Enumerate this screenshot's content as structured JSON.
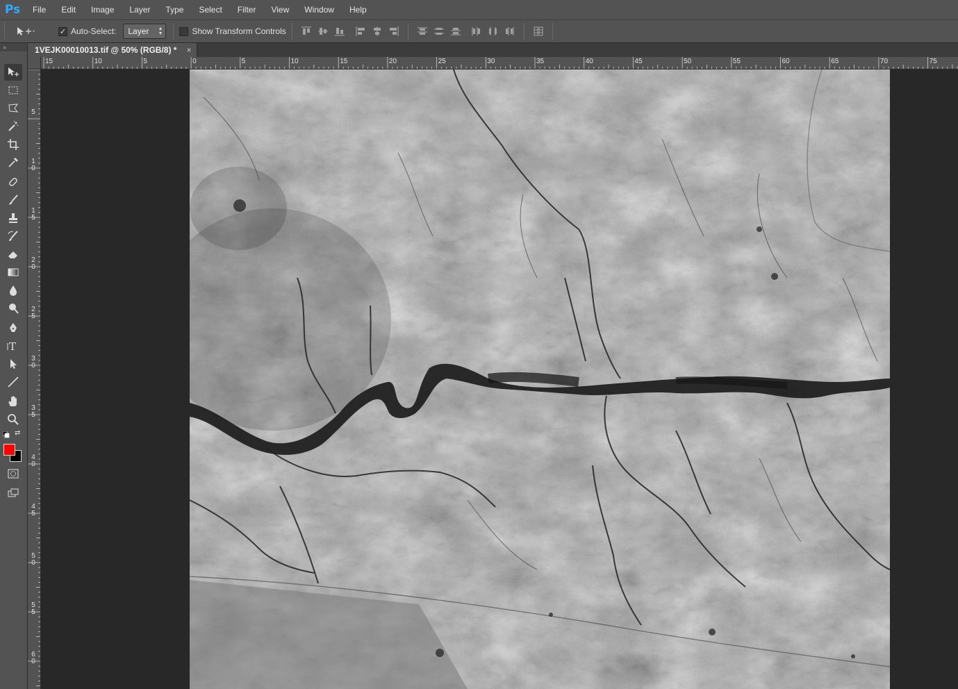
{
  "app": {
    "logo": "Ps",
    "menu": [
      "File",
      "Edit",
      "Image",
      "Layer",
      "Type",
      "Select",
      "Filter",
      "View",
      "Window",
      "Help"
    ]
  },
  "options": {
    "auto_select_label": "Auto-Select:",
    "auto_select_checked": true,
    "auto_select_target": "Layer",
    "show_transform_label": "Show Transform Controls",
    "show_transform_checked": false
  },
  "document": {
    "tab_title": "1VEJK00010013.tif @ 50% (RGB/8) *",
    "close_glyph": "×"
  },
  "rulers": {
    "horizontal": [
      "15",
      "10",
      "5",
      "0",
      "5",
      "10",
      "15",
      "20",
      "25",
      "30",
      "35",
      "40",
      "45",
      "50",
      "55",
      "60",
      "65",
      "70",
      "75"
    ],
    "vertical": [
      "5",
      "10",
      "15",
      "20",
      "25",
      "30",
      "35",
      "40",
      "45",
      "50",
      "55",
      "60"
    ]
  },
  "colors": {
    "foreground": "#ff0000",
    "background": "#000000"
  },
  "tools": [
    "move-icon",
    "marquee-icon",
    "lasso-icon",
    "magic-wand-icon",
    "crop-icon",
    "eyedropper-icon",
    "healing-brush-icon",
    "brush-icon",
    "clone-stamp-icon",
    "history-brush-icon",
    "eraser-icon",
    "gradient-icon",
    "blur-icon",
    "dodge-icon",
    "pen-icon",
    "type-icon",
    "path-selection-icon",
    "line-icon",
    "hand-icon",
    "zoom-icon"
  ]
}
